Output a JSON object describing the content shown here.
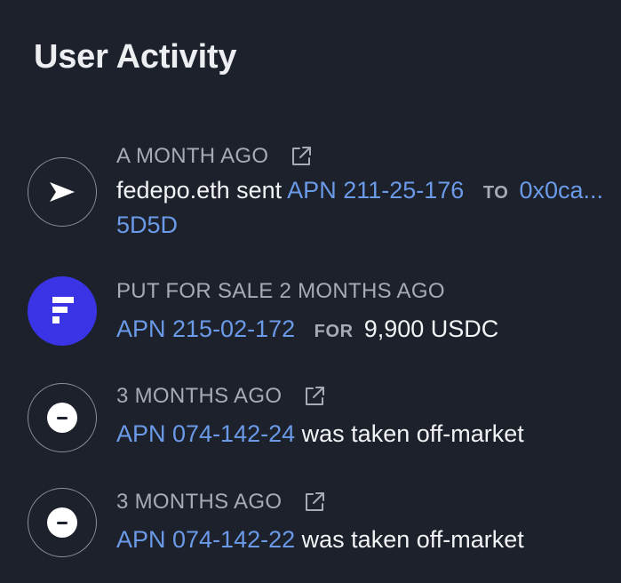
{
  "panel": {
    "title": "User Activity"
  },
  "activities": [
    {
      "icon": "send-icon",
      "time": "A MONTH AGO",
      "external_link_icon": "external-link-icon",
      "actor": "fedepo.eth sent",
      "asset": "APN 211-25-176",
      "keyword": "TO",
      "recipient_line1": "0x0ca...",
      "recipient_line2": "5D5D"
    },
    {
      "icon": "platform-logo",
      "time": "PUT FOR SALE 2 MONTHS AGO",
      "asset": "APN 215-02-172",
      "keyword": "FOR",
      "price": "9,900 USDC"
    },
    {
      "icon": "off-market-icon",
      "time": "3 MONTHS AGO",
      "external_link_icon": "external-link-icon",
      "asset": "APN 074-142-24",
      "action": "was taken off-market"
    },
    {
      "icon": "off-market-icon",
      "time": "3 MONTHS AGO",
      "external_link_icon": "external-link-icon",
      "asset": "APN 074-142-22",
      "action": "was taken off-market"
    }
  ],
  "colors": {
    "background": "#1c212b",
    "link": "#6b9ae8",
    "muted": "#a6abb4",
    "brand": "#3b34e6"
  }
}
